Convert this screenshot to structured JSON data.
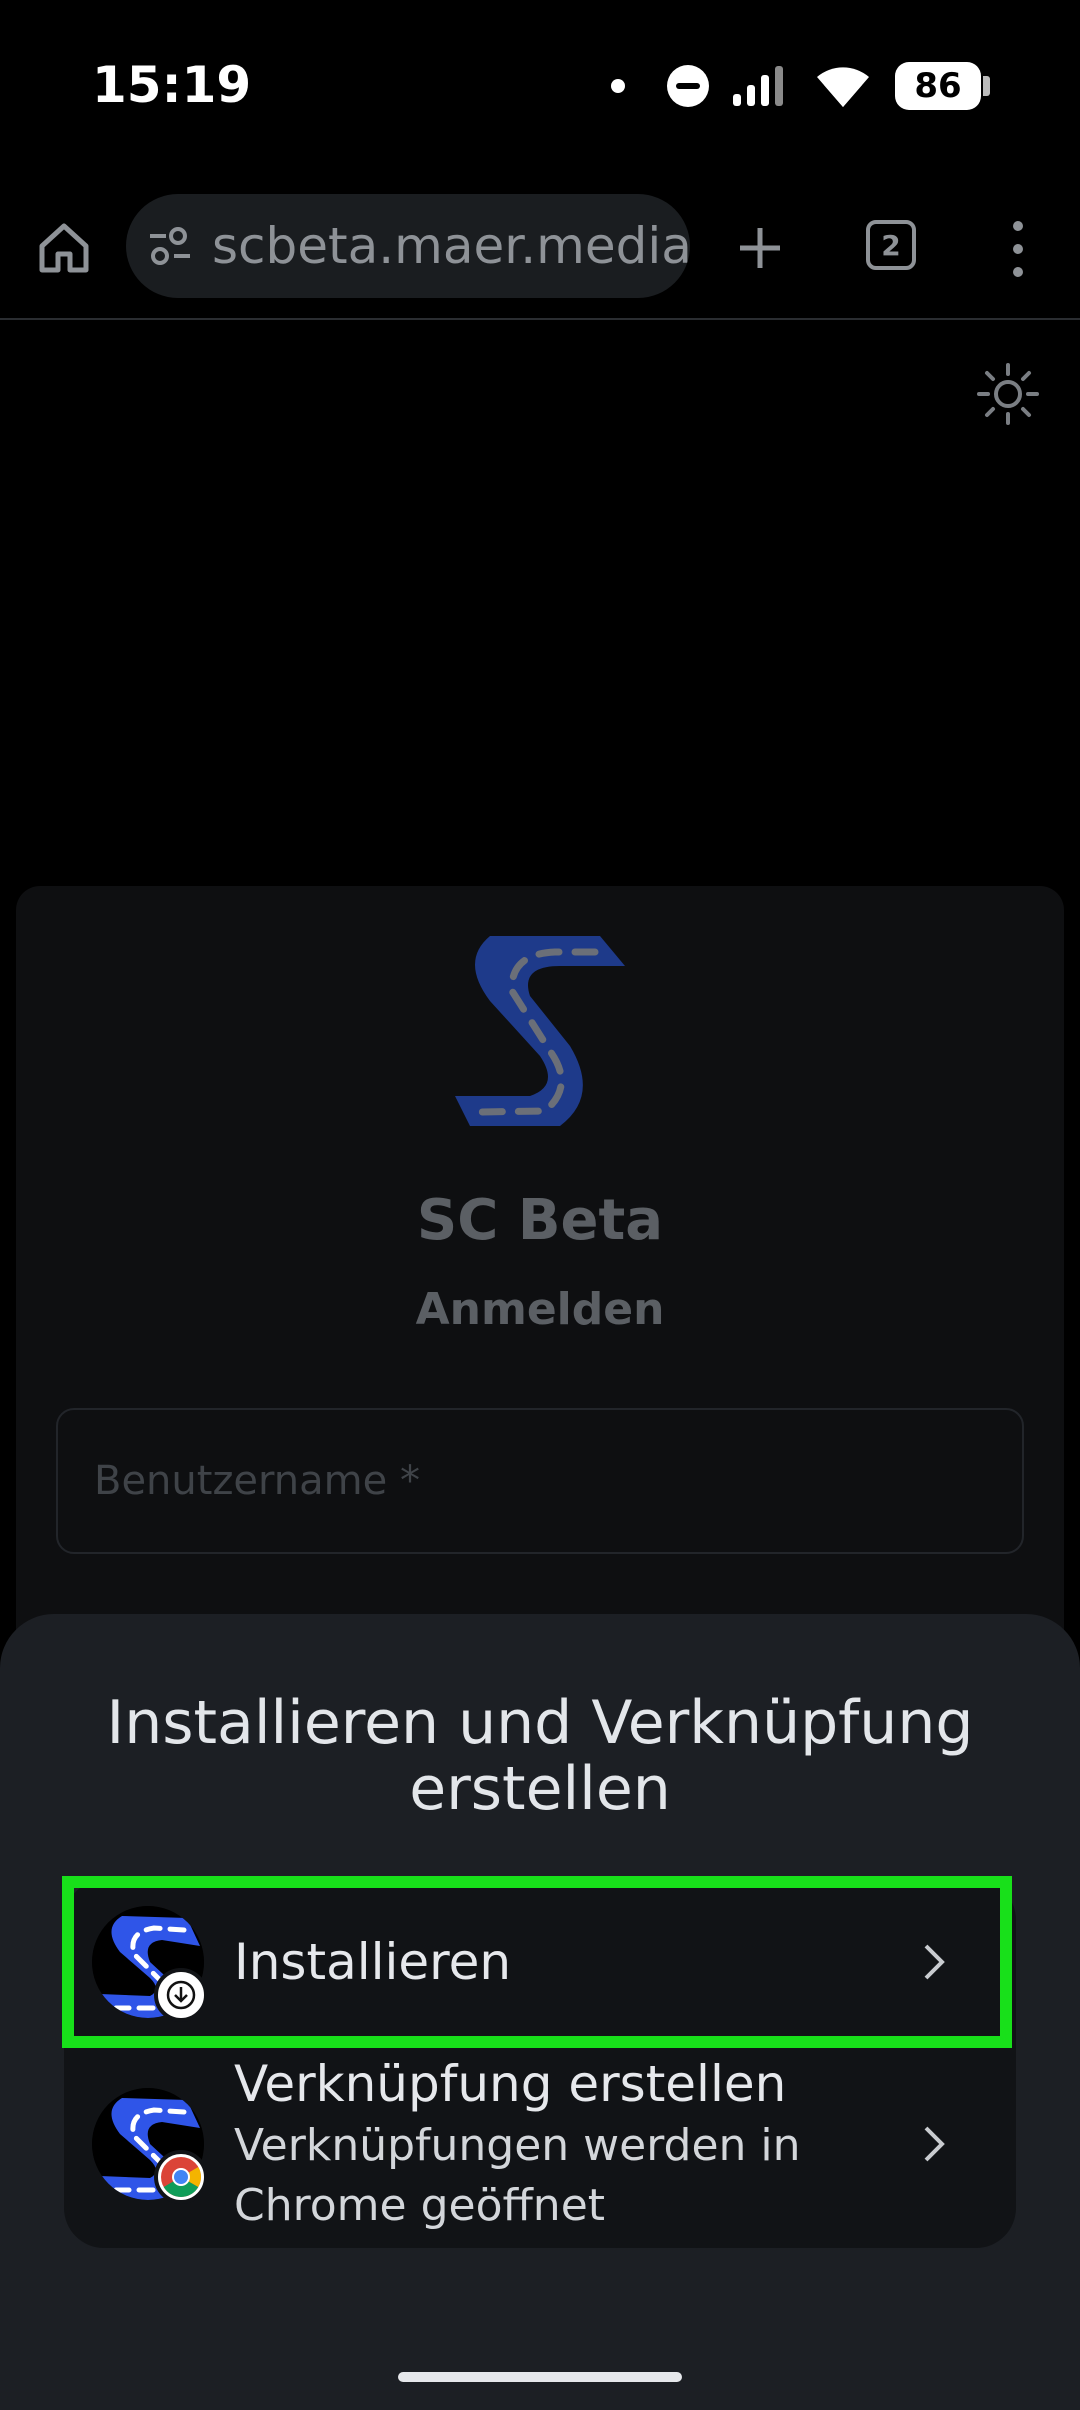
{
  "status_bar": {
    "time": "15:19",
    "battery": "86",
    "icons": [
      "notification-dot-icon",
      "do-not-disturb-icon",
      "signal-icon",
      "wifi-icon",
      "battery-icon"
    ]
  },
  "browser": {
    "url": "scbeta.maer.media",
    "tab_count": "2",
    "icons": [
      "home-icon",
      "site-settings-icon",
      "new-tab-icon",
      "tab-switcher-icon",
      "more-menu-icon"
    ]
  },
  "page": {
    "app_name": "SC Beta",
    "login_heading": "Anmelden",
    "username_placeholder": "Benutzername *",
    "theme_toggle_icon": "sun-icon",
    "logo_color": "#1e3a8a"
  },
  "sheet": {
    "title": "Installieren und Verknüpfung erstellen",
    "options": [
      {
        "label": "Installieren",
        "badge_icon": "download-icon"
      },
      {
        "label": "Verknüpfung erstellen",
        "description": "Verknüpfungen werden in Chrome geöffnet",
        "badge_icon": "chrome-icon"
      }
    ],
    "highlight_color": "#18e01a"
  }
}
